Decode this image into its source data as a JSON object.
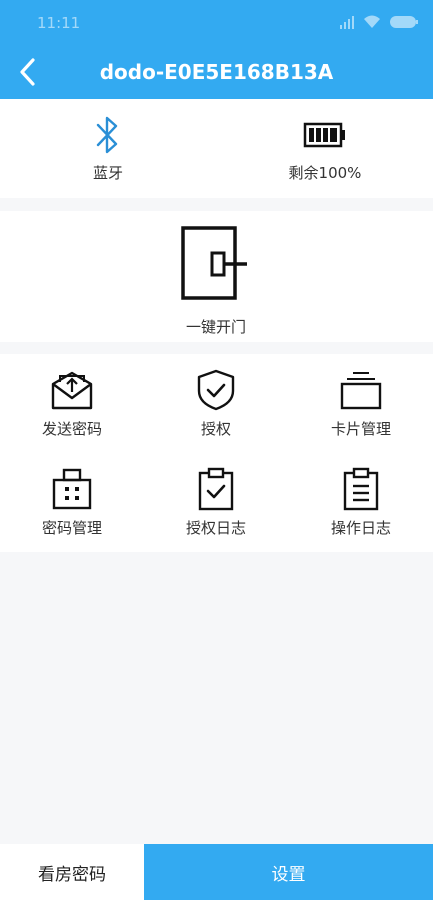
{
  "status_bar": {
    "time": "11:11",
    "icons": [
      "signal-icon",
      "wifi-icon",
      "battery-icon"
    ]
  },
  "header": {
    "title": "dodo-E0E5E168B13A",
    "back_icon": "chevron-left-icon"
  },
  "device_info": {
    "bluetooth": {
      "icon": "bluetooth-icon",
      "label": "蓝牙"
    },
    "battery": {
      "icon": "battery-full-icon",
      "label": "剩余100%",
      "level_percent": 100
    }
  },
  "open_door": {
    "icon": "door-icon",
    "label": "一键开门"
  },
  "menu": [
    {
      "icon": "send-envelope-icon",
      "label": "发送密码"
    },
    {
      "icon": "shield-check-icon",
      "label": "授权"
    },
    {
      "icon": "card-stack-icon",
      "label": "卡片管理"
    },
    {
      "icon": "keypad-icon",
      "label": "密码管理"
    },
    {
      "icon": "clipboard-check-icon",
      "label": "授权日志"
    },
    {
      "icon": "clipboard-list-icon",
      "label": "操作日志"
    }
  ],
  "bottom": {
    "left_label": "看房密码",
    "right_label": "设置"
  },
  "colors": {
    "primary": "#33aaf1",
    "background": "#f6f7f9",
    "icon_blue": "#2a8fd6"
  }
}
